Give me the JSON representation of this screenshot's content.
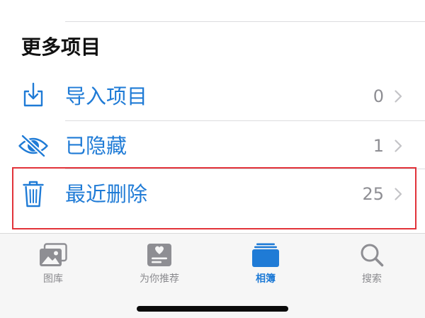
{
  "section": {
    "title": "更多项目"
  },
  "rows": [
    {
      "label": "导入项目",
      "count": "0",
      "icon": "import-icon"
    },
    {
      "label": "已隐藏",
      "count": "1",
      "icon": "eye-slash-icon"
    },
    {
      "label": "最近删除",
      "count": "25",
      "icon": "trash-icon",
      "highlighted": true
    }
  ],
  "tabbar": {
    "tabs": [
      {
        "label": "图库",
        "icon": "photo-library-icon",
        "active": false
      },
      {
        "label": "为你推荐",
        "icon": "for-you-icon",
        "active": false
      },
      {
        "label": "相簿",
        "icon": "albums-icon",
        "active": true
      },
      {
        "label": "搜索",
        "icon": "search-icon",
        "active": false
      }
    ]
  },
  "colors": {
    "accent": "#1f7bd6",
    "secondary_text": "#8e8e93",
    "chevron": "#c4c4c7",
    "highlight": "#e2333a",
    "tabbar_background": "#f6f6f6"
  }
}
